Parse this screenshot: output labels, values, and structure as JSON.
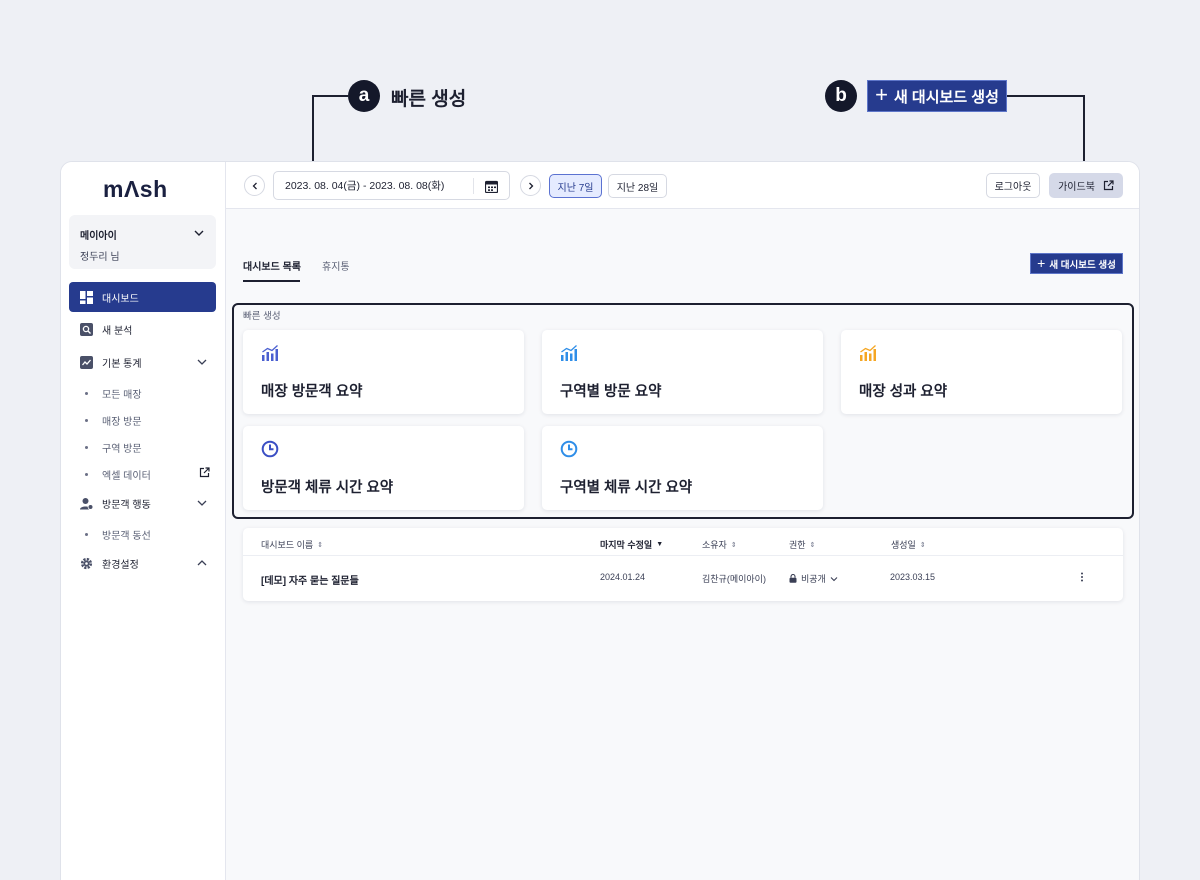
{
  "callouts": {
    "a": {
      "badge": "a",
      "label": "빠른 생성"
    },
    "b": {
      "badge": "b",
      "label": "새 대시보드 생성"
    }
  },
  "brand": {
    "logo": "mΛsh"
  },
  "org": {
    "name": "메이아이",
    "user": "정두리 님"
  },
  "sidebar": {
    "items": [
      {
        "label": "대시보드",
        "icon": "dashboard-icon",
        "active": true
      },
      {
        "label": "새 분석",
        "icon": "search-analysis-icon"
      },
      {
        "label": "기본 통계",
        "icon": "chart-line-icon",
        "expand": "chevron-down"
      },
      {
        "label": "방문객 행동",
        "icon": "visitor-behavior-icon",
        "expand": "chevron-down"
      },
      {
        "label": "환경설정",
        "icon": "gear-icon",
        "expand": "chevron-up"
      }
    ],
    "stats_sub": [
      "모든 매장",
      "매장 방문",
      "구역 방문",
      "엑셀 데이터"
    ],
    "behavior_sub": [
      "방문객 동선"
    ]
  },
  "topbar": {
    "date_range": "2023. 08. 04(금) - 2023. 08. 08(화)",
    "period_7": "지난 7일",
    "period_28": "지난 28일",
    "logout": "로그아웃",
    "guide": "가이드북"
  },
  "tabs": {
    "list": "대시보드 목록",
    "trash": "휴지통"
  },
  "new_dashboard": "새 대시보드 생성",
  "quick_create": {
    "title": "빠른 생성",
    "cards": [
      {
        "label": "매장 방문객 요약",
        "icon": "bar-chart-icon",
        "color": "#4a5fd0"
      },
      {
        "label": "구역별 방문 요약",
        "icon": "bar-chart-icon",
        "color": "#2f8ee8"
      },
      {
        "label": "매장 성과 요약",
        "icon": "bar-chart-icon",
        "color": "#f5a623"
      },
      {
        "label": "방문객 체류 시간 요약",
        "icon": "clock-icon",
        "color": "#3b4fc4"
      },
      {
        "label": "구역별 체류 시간 요약",
        "icon": "clock-icon",
        "color": "#2f8ee8"
      }
    ]
  },
  "table": {
    "headers": [
      "대시보드 이름",
      "마지막 수정일",
      "소유자",
      "권한",
      "생성일"
    ],
    "rows": [
      {
        "name": "[데모] 자주 묻는 질문들",
        "modified": "2024.01.24",
        "owner": "김찬규(메이아이)",
        "permission": "비공개",
        "created": "2023.03.15"
      }
    ]
  },
  "colors": {
    "primary": "#263b8e",
    "accent_light": "#e5ebff"
  }
}
